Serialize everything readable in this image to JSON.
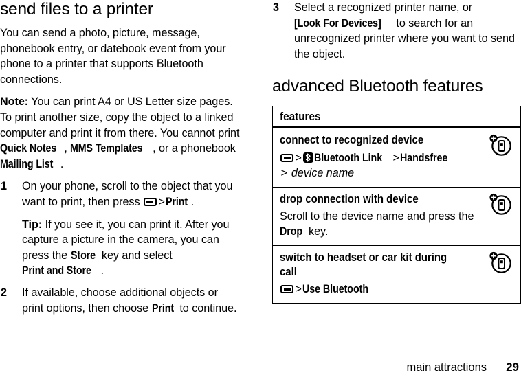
{
  "left_column": {
    "heading": "send files to a printer",
    "intro": "You can send a photo, picture, message, phonebook entry, or datebook event from your phone to a printer that supports Bluetooth connections.",
    "note_label": "Note:",
    "note_part1": " You can print A4 or US Letter size pages. To print another size, copy the object to a linked computer and print it from there. You cannot print ",
    "note_ui1": "Quick Notes",
    "note_part2": ", ",
    "note_ui2": "MMS Templates",
    "note_part3": ", or a phonebook ",
    "note_ui3": "Mailing List",
    "note_part4": ".",
    "steps": [
      {
        "number": "1",
        "text_part1": "On your phone, scroll to the object that you want to print, then press ",
        "menu_icon": "menu-key-icon",
        "arrow": ">",
        "ui_label": "Print",
        "text_part2": ".",
        "tip_label": "Tip:",
        "tip_part1": " If you see it, you can print it. After you capture a picture in the camera, you can press the ",
        "tip_ui1": "Store",
        "tip_part2": " key and select ",
        "tip_ui2": "Print and Store",
        "tip_part3": "."
      },
      {
        "number": "2",
        "text_part1": "If available, choose additional objects or print options, then choose ",
        "ui_label": "Print",
        "text_part2": " to continue."
      }
    ]
  },
  "right_column": {
    "step3": {
      "number": "3",
      "text_part1": "Select a recognized printer name, or ",
      "ui_label": "[Look For Devices]",
      "text_part2": " to search for an unrecognized printer where you want to send the object."
    },
    "heading": "advanced Bluetooth features",
    "table": {
      "header": "features",
      "rows": [
        {
          "title": "connect to recognized device",
          "icon": "phone-add-circle-icon",
          "path_segments": [
            {
              "type": "menu-icon",
              "value": "menu-key-icon"
            },
            {
              "type": "arrow",
              "value": ">"
            },
            {
              "type": "bluetooth-icon",
              "value": "bluetooth-icon"
            },
            {
              "type": "label",
              "value": "Bluetooth Link"
            },
            {
              "type": "arrow",
              "value": ">"
            },
            {
              "type": "label",
              "value": "Handsfree"
            },
            {
              "type": "arrow",
              "value": ">"
            },
            {
              "type": "italic",
              "value": "device name"
            }
          ]
        },
        {
          "title": "drop connection with device",
          "icon": "phone-add-circle-icon",
          "body_part1": "Scroll to the device name and press the ",
          "body_ui": "Drop",
          "body_part2": " key."
        },
        {
          "title": "switch to headset or car kit during call",
          "icon": "phone-add-circle-icon",
          "path_segments": [
            {
              "type": "menu-icon",
              "value": "menu-key-icon"
            },
            {
              "type": "arrow",
              "value": ">"
            },
            {
              "type": "label",
              "value": "Use Bluetooth"
            }
          ]
        }
      ]
    }
  },
  "footer": {
    "chapter": "main attractions",
    "page_number": "29"
  },
  "colors": {
    "text": "#000000",
    "background": "#ffffff",
    "rule": "#000000"
  }
}
